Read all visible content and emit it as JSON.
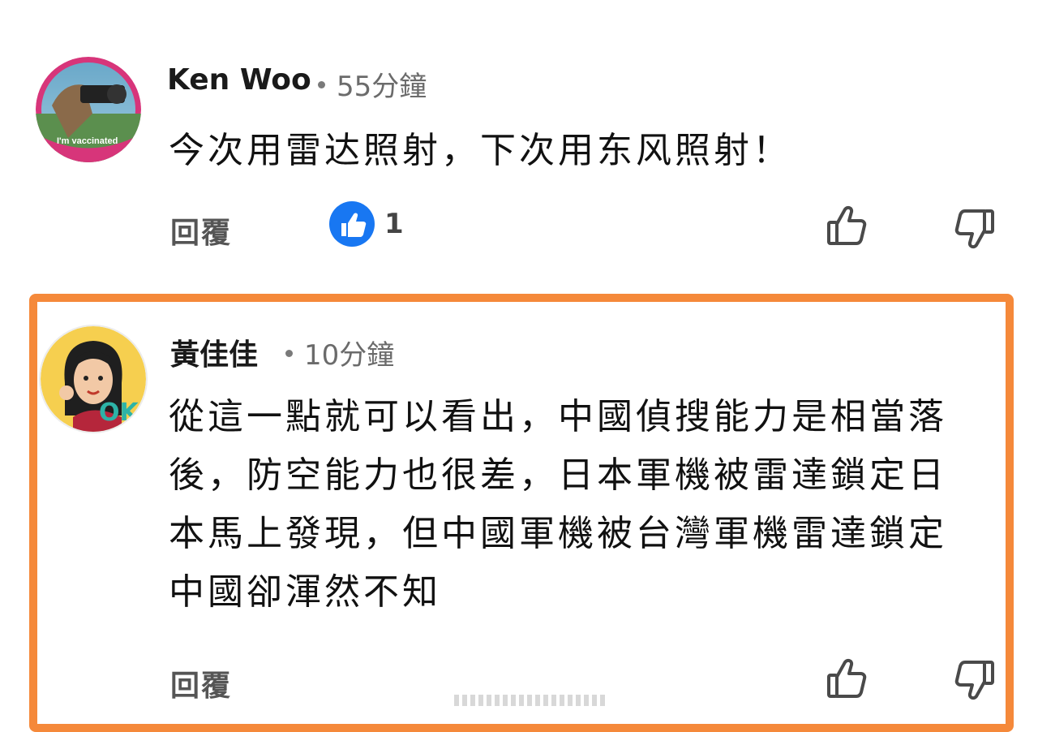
{
  "comments": [
    {
      "author": "Ken Woo",
      "time": "55分鐘",
      "text": "今次用雷达照射，下次用东风照射！",
      "reply_label": "回覆",
      "like_count": "1",
      "avatar_badge": "I'm vaccinated"
    },
    {
      "author": "黃佳佳",
      "time": "10分鐘",
      "text": "從這一點就可以看出，中國偵搜能力是相當落後，防空能力也很差，日本軍機被雷達鎖定日本馬上發現，但中國軍機被台灣軍機雷達鎖定中國卻渾然不知",
      "reply_label": "回覆"
    }
  ],
  "icons": {
    "like_badge": "thumbs-up-icon",
    "upvote": "thumbs-up-outline-icon",
    "downvote": "thumbs-down-outline-icon"
  },
  "colors": {
    "highlight": "#f5893a",
    "like_badge": "#1877f2"
  }
}
